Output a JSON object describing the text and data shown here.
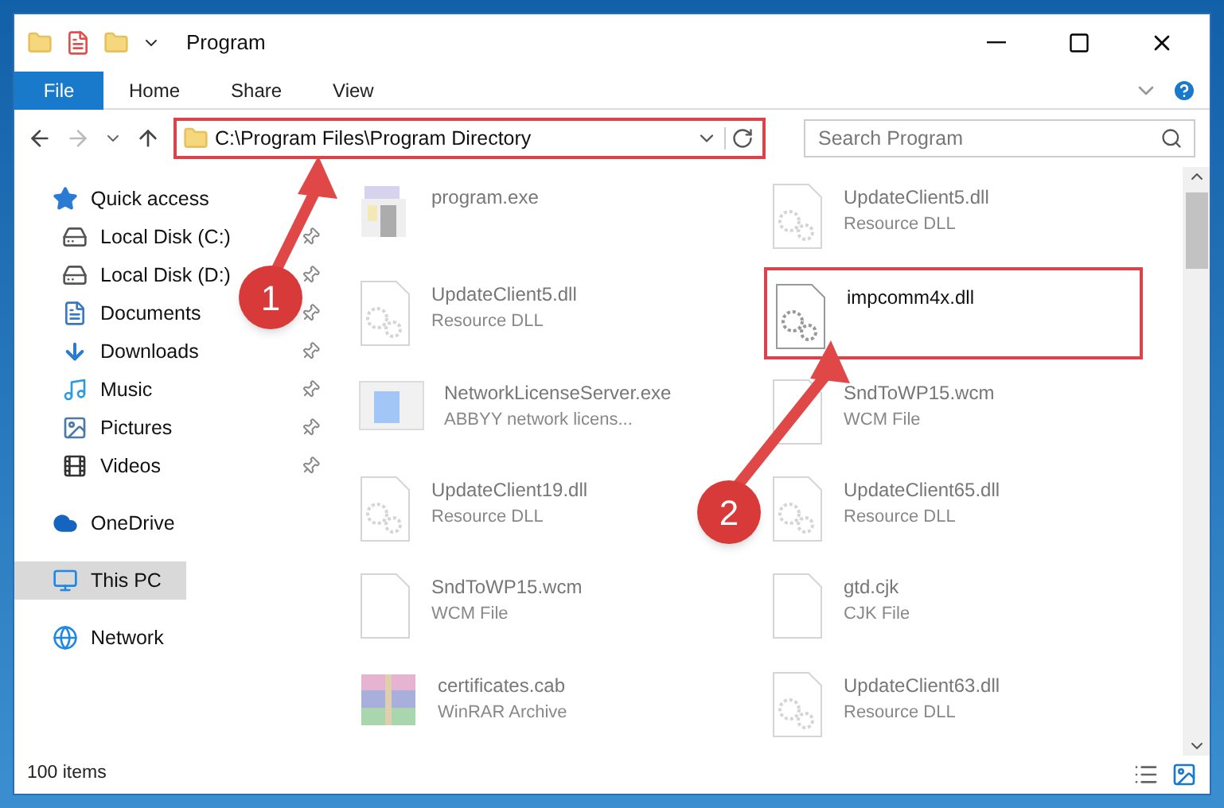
{
  "window": {
    "title": "Program"
  },
  "ribbon_tabs": [
    {
      "label": "File",
      "selected": true
    },
    {
      "label": "Home",
      "selected": false
    },
    {
      "label": "Share",
      "selected": false
    },
    {
      "label": "View",
      "selected": false
    }
  ],
  "address_bar": {
    "path": "C:\\Program Files\\Program Directory",
    "highlighted": true
  },
  "search": {
    "placeholder": "Search Program"
  },
  "sidebar": {
    "items": [
      {
        "label": "Quick access",
        "kind": "star",
        "pinned": false,
        "selected": false,
        "children": [
          {
            "label": "Local Disk (C:)",
            "kind": "disk-c",
            "pinned": true,
            "selected": false
          },
          {
            "label": "Local Disk (D:)",
            "kind": "disk",
            "pinned": true,
            "selected": false
          },
          {
            "label": "Documents",
            "kind": "doc",
            "pinned": true,
            "selected": false
          },
          {
            "label": "Downloads",
            "kind": "download",
            "pinned": true,
            "selected": false
          },
          {
            "label": "Music",
            "kind": "music",
            "pinned": true,
            "selected": false
          },
          {
            "label": "Pictures",
            "kind": "pictures",
            "pinned": true,
            "selected": false
          },
          {
            "label": "Videos",
            "kind": "video",
            "pinned": true,
            "selected": false
          }
        ]
      },
      {
        "label": "OneDrive",
        "kind": "cloud",
        "pinned": false,
        "selected": false
      },
      {
        "label": "This PC",
        "kind": "pc",
        "pinned": false,
        "selected": true
      },
      {
        "label": "Network",
        "kind": "network",
        "pinned": false,
        "selected": false
      }
    ]
  },
  "files": [
    {
      "name": "program.exe",
      "kind": "exe",
      "faded": true,
      "highlighted": false
    },
    {
      "name": "UpdateClient5.dll",
      "type": "Resource DLL",
      "kind": "dll",
      "faded": true,
      "highlighted": false
    },
    {
      "name": "UpdateClient5.dll",
      "type": "Resource DLL",
      "kind": "dll",
      "faded": true,
      "highlighted": false
    },
    {
      "name": "impcomm4x.dll",
      "kind": "dll",
      "faded": false,
      "highlighted": true
    },
    {
      "name": "NetworkLicenseServer.exe",
      "type": "ABBYY network licens...",
      "kind": "app",
      "faded": true,
      "highlighted": false
    },
    {
      "name": "SndToWP15.wcm",
      "type": "WCM File",
      "kind": "blank",
      "faded": true,
      "highlighted": false
    },
    {
      "name": "UpdateClient19.dll",
      "type": "Resource DLL",
      "kind": "dll",
      "faded": true,
      "highlighted": false
    },
    {
      "name": "UpdateClient65.dll",
      "type": "Resource DLL",
      "kind": "dll",
      "faded": true,
      "highlighted": false
    },
    {
      "name": "SndToWP15.wcm",
      "type": "WCM File",
      "kind": "blank",
      "faded": true,
      "highlighted": false
    },
    {
      "name": "gtd.cjk",
      "type": "CJK File",
      "kind": "blank",
      "faded": true,
      "highlighted": false
    },
    {
      "name": "certificates.cab",
      "type": "WinRAR Archive",
      "kind": "archive",
      "faded": true,
      "highlighted": false
    },
    {
      "name": "UpdateClient63.dll",
      "type": "Resource DLL",
      "kind": "dll",
      "faded": true,
      "highlighted": false
    }
  ],
  "status_bar": {
    "item_count": "100 items"
  },
  "callouts": [
    {
      "label": "1"
    },
    {
      "label": "2"
    }
  ]
}
